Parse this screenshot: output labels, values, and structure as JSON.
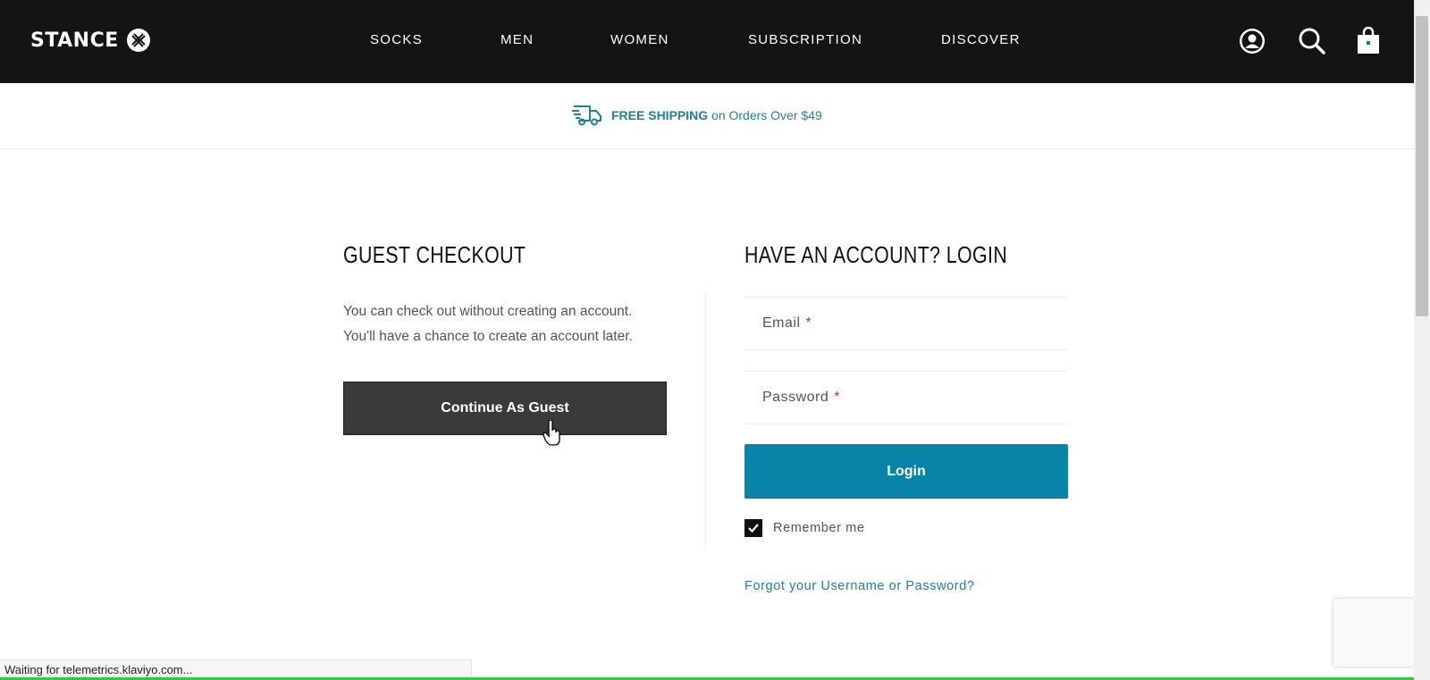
{
  "header": {
    "logo_text": "STANCE",
    "nav": [
      "SOCKS",
      "MEN",
      "WOMEN",
      "SUBSCRIPTION",
      "DISCOVER"
    ],
    "icons": [
      "account-icon",
      "search-icon",
      "cart-icon"
    ]
  },
  "promo": {
    "icon": "shipping-truck-icon",
    "strong": "FREE SHIPPING",
    "rest": " on Orders Over $49"
  },
  "guest": {
    "title": "GUEST CHECKOUT",
    "line1": "You can check out without creating an account.",
    "line2": "You'll have a chance to create an account later.",
    "button": "Continue As Guest"
  },
  "login": {
    "title": "HAVE AN ACCOUNT? LOGIN",
    "email_placeholder": "Email",
    "password_placeholder": "Password",
    "required_mark": "*",
    "button": "Login",
    "remember_label": "Remember me",
    "remember_checked": true,
    "forgot_link": "Forgot your Username or Password?"
  },
  "status_bar": "Waiting for telemetrics.klaviyo.com...",
  "colors": {
    "header_bg": "#141414",
    "accent": "#0884a8",
    "link": "#1b8499",
    "guest_button": "#3a3a3a"
  }
}
